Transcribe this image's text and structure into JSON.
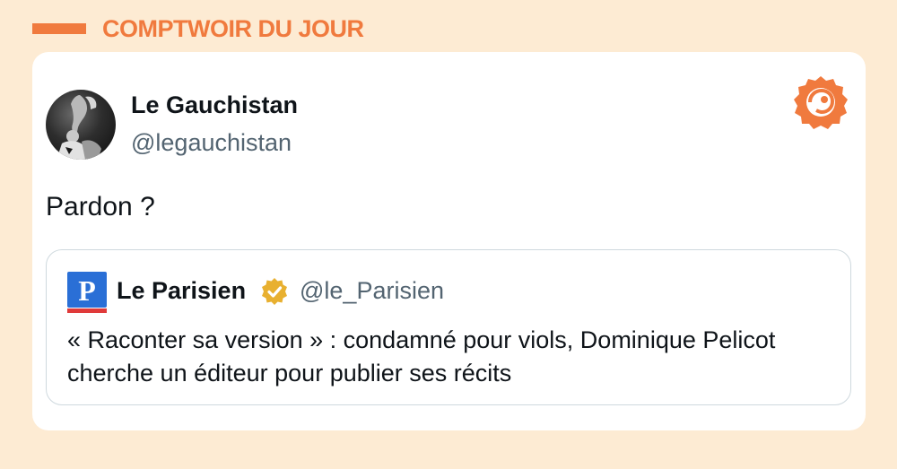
{
  "header": {
    "title": "COMPTWOIR DU JOUR"
  },
  "tweet": {
    "author_name": "Le Gauchistan",
    "author_handle": "@legauchistan",
    "text": "Pardon ?",
    "avatar_icon": "avatar-photo",
    "brand_icon": "brand-logo-icon"
  },
  "quoted_tweet": {
    "logo_letter": "P",
    "author_name": "Le Parisien",
    "verified_icon": "verified-badge-icon",
    "author_handle": "@le_Parisien",
    "text": "« Raconter sa version » : condamné pour viols, Dominique Pelicot cherche un éditeur pour publier ses récits"
  },
  "colors": {
    "page_background": "#fdebd3",
    "accent": "#f07a3e",
    "handle_gray": "#536471",
    "verified_gold": "#e8b030",
    "parisien_blue": "#2a6fd6",
    "parisien_red": "#e03a3a"
  }
}
